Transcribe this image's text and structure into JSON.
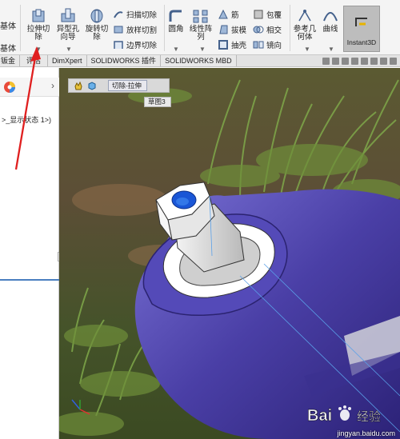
{
  "ribbon": {
    "partial_items": [
      "基体",
      "基体"
    ],
    "buttons": [
      {
        "label": "拉伸切除",
        "icon": "extruded-cut-icon"
      },
      {
        "label": "异型孔向导",
        "icon": "hole-wizard-icon"
      },
      {
        "label": "旋转切除",
        "icon": "revolved-cut-icon"
      }
    ],
    "cut_group": [
      "扫描切除",
      "放样切割",
      "边界切除"
    ],
    "fillet": "圆角",
    "linear_pattern": "线性阵列",
    "rib_group": [
      "筋",
      "拔模",
      "抽壳"
    ],
    "wrap_group": [
      "包覆",
      "相交",
      "镜向"
    ],
    "ref_geometry": "参考几何体",
    "curves": "曲线",
    "instant3d": "Instant3D"
  },
  "tabs": [
    "钣金",
    "评估",
    "DimXpert",
    "SOLIDWORKS 插件",
    "SOLIDWORKS MBD"
  ],
  "left_panel": {
    "tree_text": ">_显示状态 1>)"
  },
  "viewport": {
    "breadcrumb_cut": "切除-拉伸",
    "sketch_tag": "草图3",
    "model_colors": {
      "body": "#4a3fa6",
      "collar": "#ffffff",
      "hex_nut": "#e6e6e6",
      "hole": "#1a56d6"
    }
  },
  "watermark": {
    "logo": "Bai du 经验",
    "url": "jingyan.baidu.com"
  },
  "annotation": {
    "arrow_color": "#e02020"
  }
}
